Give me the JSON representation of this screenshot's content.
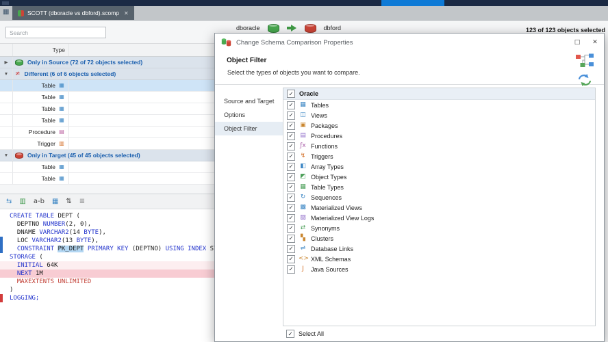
{
  "tab": {
    "title": "SCOTT (dboracle vs dbford).scomp"
  },
  "search": {
    "placeholder": "Search"
  },
  "compare_header": {
    "source": "dboracle",
    "target": "dbford",
    "summary": "123 of 123 objects selected"
  },
  "grid": {
    "type_header": "Type",
    "groups": [
      {
        "icon": "database-green-icon",
        "arrow": "▶",
        "label": "Only in Source (72 of 72 objects selected)",
        "rows": []
      },
      {
        "icon": "not-equal-icon",
        "arrow": "▼",
        "label": "Different (6 of 6 objects selected)",
        "rows": [
          {
            "type": "Table",
            "icon": "table-icon",
            "selected": true
          },
          {
            "type": "Table",
            "icon": "table-icon"
          },
          {
            "type": "Table",
            "icon": "table-icon"
          },
          {
            "type": "Table",
            "icon": "table-icon"
          },
          {
            "type": "Procedure",
            "icon": "procedure-icon"
          },
          {
            "type": "Trigger",
            "icon": "trigger-icon"
          }
        ]
      },
      {
        "icon": "database-red-icon",
        "arrow": "▼",
        "label": "Only in Target (45 of 45 objects selected)",
        "rows": [
          {
            "type": "Table",
            "icon": "table-icon"
          },
          {
            "type": "Table",
            "icon": "table-icon"
          }
        ]
      }
    ]
  },
  "editor": {
    "toolbar_icons": [
      "sync-comparison-icon",
      "export-script-icon",
      "ab-compare-icon",
      "data-grid-icon",
      "sort-icon",
      "format-lines-icon"
    ],
    "lines": [
      {
        "segs": [
          {
            "t": "CREATE TABLE",
            "c": "kw"
          },
          {
            "t": " DEPT ("
          }
        ]
      },
      {
        "segs": [
          {
            "t": "  DEPTNO "
          },
          {
            "t": "NUMBER",
            "c": "kw"
          },
          {
            "t": "(2, 0),"
          }
        ]
      },
      {
        "segs": [
          {
            "t": "  DNAME "
          },
          {
            "t": "VARCHAR2",
            "c": "kw"
          },
          {
            "t": "(14 "
          },
          {
            "t": "BYTE",
            "c": "kw"
          },
          {
            "t": "),"
          }
        ]
      },
      {
        "segs": [
          {
            "t": "  LOC "
          },
          {
            "t": "VARCHAR2",
            "c": "kw"
          },
          {
            "t": "(13 "
          },
          {
            "t": "BYTE",
            "c": "kw"
          },
          {
            "t": "),"
          }
        ],
        "mark": "blue"
      },
      {
        "segs": [
          {
            "t": "  "
          },
          {
            "t": "CONSTRAINT",
            "c": "kw"
          },
          {
            "t": " "
          },
          {
            "t": "PK_DEPT",
            "c": "sel"
          },
          {
            "t": " "
          },
          {
            "t": "PRIMARY KEY",
            "c": "kw"
          },
          {
            "t": " (DEPTNO) "
          },
          {
            "t": "USING INDEX",
            "c": "kw"
          },
          {
            "t": " ST"
          }
        ],
        "mark": "blue"
      },
      {
        "segs": [
          {
            "t": "STORAGE",
            "c": "kw"
          },
          {
            "t": " ("
          }
        ]
      },
      {
        "segs": [
          {
            "t": "  "
          },
          {
            "t": "INITIAL",
            "c": "kw"
          },
          {
            "t": " 64K"
          }
        ],
        "bg": "light"
      },
      {
        "segs": [
          {
            "t": "  "
          },
          {
            "t": "NEXT",
            "c": "kw"
          },
          {
            "t": " 1M"
          }
        ],
        "bg": "strong"
      },
      {
        "segs": [
          {
            "t": "  "
          },
          {
            "t": "MAXEXTENTS UNLIMITED",
            "c": "red"
          }
        ]
      },
      {
        "segs": [
          {
            "t": ")"
          }
        ]
      },
      {
        "segs": [
          {
            "t": "LOGGING;",
            "c": "kw"
          }
        ],
        "mark": "red"
      }
    ]
  },
  "dialog": {
    "title": "Change Schema Comparison Properties",
    "page": {
      "title": "Object Filter",
      "subtitle": "Select the types of objects you want to compare."
    },
    "nav_items": [
      {
        "label": "Source and Target"
      },
      {
        "label": "Options"
      },
      {
        "label": "Object Filter",
        "selected": true
      }
    ],
    "tree": {
      "root": {
        "label": "Oracle",
        "checked": true
      },
      "items": [
        {
          "label": "Tables",
          "icon": "tables-icon",
          "checked": true
        },
        {
          "label": "Views",
          "icon": "views-icon",
          "checked": true
        },
        {
          "label": "Packages",
          "icon": "packages-icon",
          "checked": true
        },
        {
          "label": "Procedures",
          "icon": "procedures-icon",
          "checked": true
        },
        {
          "label": "Functions",
          "icon": "functions-icon",
          "checked": true
        },
        {
          "label": "Triggers",
          "icon": "triggers-icon",
          "checked": true
        },
        {
          "label": "Array Types",
          "icon": "array-types-icon",
          "checked": true
        },
        {
          "label": "Object Types",
          "icon": "object-types-icon",
          "checked": true
        },
        {
          "label": "Table Types",
          "icon": "table-types-icon",
          "checked": true
        },
        {
          "label": "Sequences",
          "icon": "sequences-icon",
          "checked": true
        },
        {
          "label": "Materialized Views",
          "icon": "materialized-views-icon",
          "checked": true
        },
        {
          "label": "Materialized View Logs",
          "icon": "materialized-view-logs-icon",
          "checked": true
        },
        {
          "label": "Synonyms",
          "icon": "synonyms-icon",
          "checked": true
        },
        {
          "label": "Clusters",
          "icon": "clusters-icon",
          "checked": true
        },
        {
          "label": "Database Links",
          "icon": "database-links-icon",
          "checked": true
        },
        {
          "label": "XML Schemas",
          "icon": "xml-schemas-icon",
          "checked": true
        },
        {
          "label": "Java Sources",
          "icon": "java-sources-icon",
          "checked": true
        }
      ]
    },
    "select_all": {
      "label": "Select All",
      "checked": true
    }
  }
}
